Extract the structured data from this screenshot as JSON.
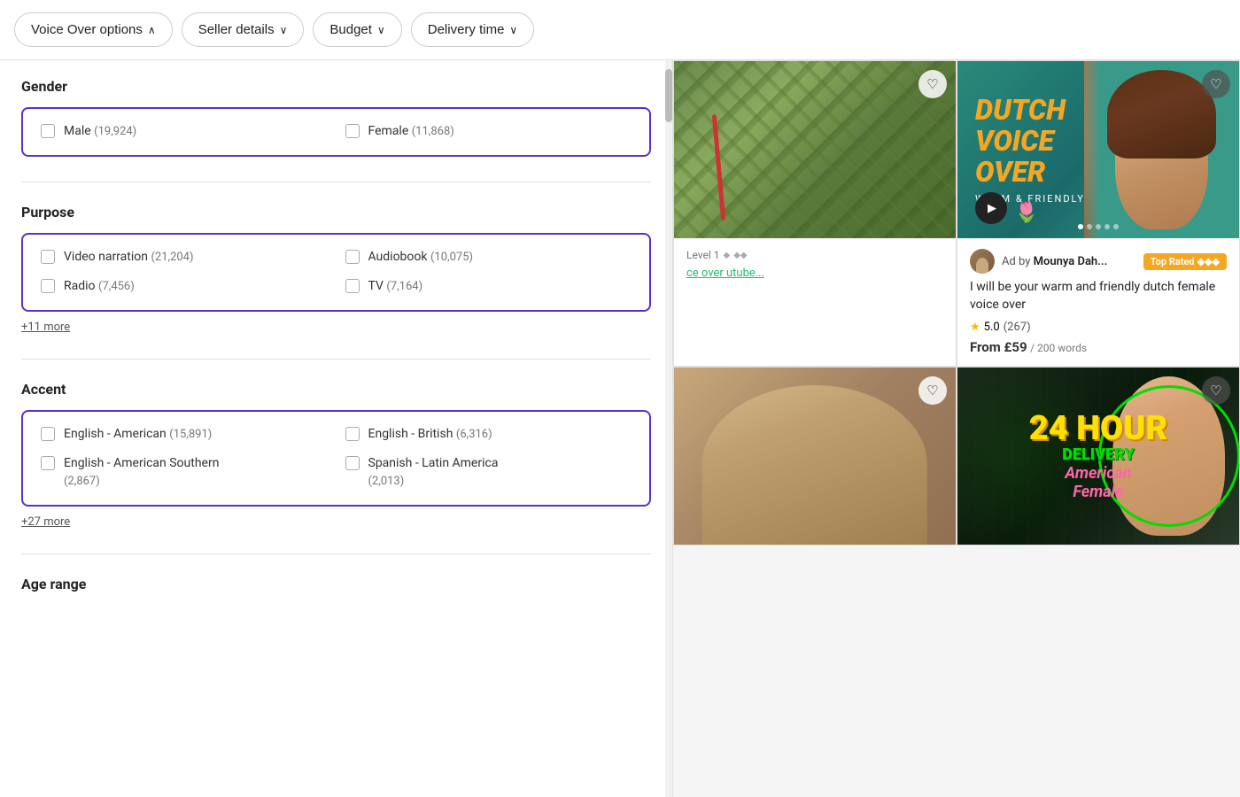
{
  "filterBar": {
    "buttons": [
      {
        "id": "voice-over-options",
        "label": "Voice Over options",
        "icon": "chevron-up",
        "active": true
      },
      {
        "id": "seller-details",
        "label": "Seller details",
        "icon": "chevron-down"
      },
      {
        "id": "budget",
        "label": "Budget",
        "icon": "chevron-down"
      },
      {
        "id": "delivery-time",
        "label": "Delivery time",
        "icon": "chevron-down"
      }
    ]
  },
  "filterPanel": {
    "sections": [
      {
        "id": "gender",
        "title": "Gender",
        "options": [
          {
            "id": "male",
            "label": "Male",
            "count": "(19,924)",
            "checked": false
          },
          {
            "id": "female",
            "label": "Female",
            "count": "(11,868)",
            "checked": false
          }
        ],
        "moreLink": null
      },
      {
        "id": "purpose",
        "title": "Purpose",
        "options": [
          {
            "id": "video-narration",
            "label": "Video narration",
            "count": "(21,204)",
            "checked": false
          },
          {
            "id": "audiobook",
            "label": "Audiobook",
            "count": "(10,075)",
            "checked": false
          },
          {
            "id": "radio",
            "label": "Radio",
            "count": "(7,456)",
            "checked": false
          },
          {
            "id": "tv",
            "label": "TV",
            "count": "(7,164)",
            "checked": false
          }
        ],
        "moreLink": "+11 more"
      },
      {
        "id": "accent",
        "title": "Accent",
        "options": [
          {
            "id": "english-american",
            "label": "English - American",
            "count": "(15,891)",
            "checked": false
          },
          {
            "id": "english-british",
            "label": "English - British",
            "count": "(6,316)",
            "checked": false
          },
          {
            "id": "english-american-southern",
            "label": "English - American Southern",
            "count": "(2,867)",
            "checked": false
          },
          {
            "id": "spanish-latin-america",
            "label": "Spanish - Latin America",
            "count": "(2,013)",
            "checked": false
          }
        ],
        "moreLink": "+27 more"
      },
      {
        "id": "age-range",
        "title": "Age range",
        "options": [],
        "moreLink": null
      }
    ]
  },
  "gigCards": [
    {
      "id": "card-1",
      "type": "aerial-farm",
      "heart": "♡",
      "levelText": "Level 1",
      "gigTitleLink": "ce over utube...",
      "rating": null,
      "price": null
    },
    {
      "id": "card-2",
      "type": "dutch-voice-over",
      "dutchText": "DUTCH\nVOICE\nOVER",
      "warmFriendly": "WARM & FRIENDLY",
      "heart": "♡",
      "heartDark": true,
      "isAd": true,
      "sellerLabel": "Ad by",
      "sellerName": "Mounya Dah...",
      "topRated": "Top Rated",
      "topRatedDiamonds": "◆◆◆",
      "gigTitle": "I will be your warm and friendly dutch female voice over",
      "ratingValue": "5.0",
      "ratingCount": "(267)",
      "priceFrom": "From £59",
      "priceUnit": "/ 200 words",
      "dots": [
        true,
        false,
        false,
        false,
        false
      ]
    },
    {
      "id": "card-3",
      "type": "person-partial",
      "heart": "♡"
    },
    {
      "id": "card-4",
      "type": "24-hour-delivery",
      "line1": "24 HOUR",
      "line2": "DELIVERY",
      "line3": "American",
      "line4": "Female",
      "heart": "♡",
      "heartDark": true
    }
  ]
}
